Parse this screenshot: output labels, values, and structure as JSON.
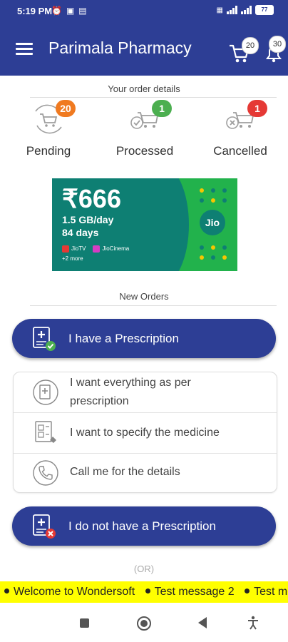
{
  "status_bar": {
    "time": "5:19 PM",
    "battery": "77"
  },
  "header": {
    "title": "Parimala Pharmacy",
    "cart_count": "20",
    "notification_count": "30"
  },
  "order_details": {
    "title": "Your order details",
    "items": [
      {
        "label": "Pending",
        "count": "20",
        "color": "#f07a20"
      },
      {
        "label": "Processed",
        "count": "1",
        "color": "#4caf50"
      },
      {
        "label": "Cancelled",
        "count": "1",
        "color": "#e53935"
      }
    ]
  },
  "banner": {
    "price": "₹666",
    "line1": "1.5 GB/day",
    "line2": "84 days",
    "app1": "JioTV",
    "app2": "JioCinema",
    "more": "+2 more",
    "logo": "Jio"
  },
  "new_orders": {
    "title": "New Orders",
    "have_prescription": "I have a Prescription",
    "options": [
      {
        "label": "I want everything as per prescription",
        "icon": "prescription-refresh-icon"
      },
      {
        "label": "I want to specify the medicine",
        "icon": "specify-medicine-icon"
      },
      {
        "label": "Call me for the details",
        "icon": "phone-icon"
      }
    ],
    "no_prescription": "I do not have a Prescription",
    "or_text": "(OR)"
  },
  "ticker": {
    "messages": [
      "Welcome to Wondersoft",
      "Test message 2",
      "Test mes"
    ]
  },
  "colors": {
    "primary": "#2d3e95",
    "ticker_bg": "#ffff00"
  }
}
